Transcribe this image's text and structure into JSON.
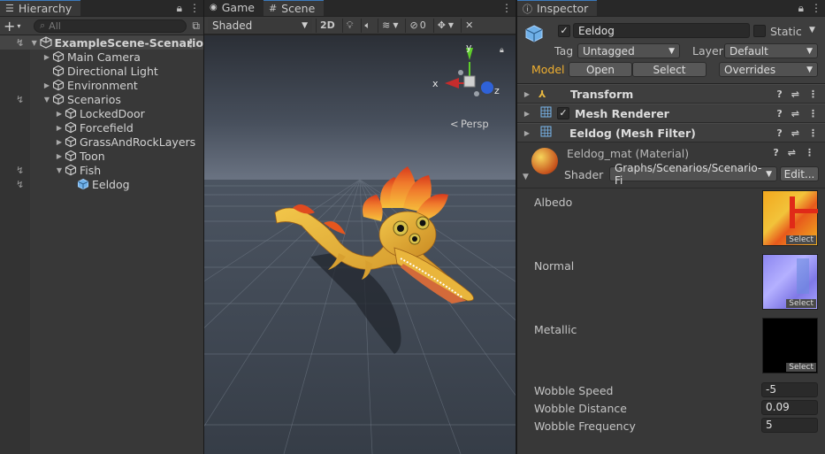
{
  "hierarchy": {
    "tab_label": "Hierarchy",
    "search_placeholder": "All",
    "scene_name": "ExampleScene-Scenario",
    "items": [
      {
        "label": "Main Camera"
      },
      {
        "label": "Directional Light"
      },
      {
        "label": "Environment"
      },
      {
        "label": "Scenarios"
      },
      {
        "label": "LockedDoor"
      },
      {
        "label": "Forcefield"
      },
      {
        "label": "GrassAndRockLayers"
      },
      {
        "label": "Toon"
      },
      {
        "label": "Fish"
      },
      {
        "label": "Eeldog"
      }
    ]
  },
  "scene": {
    "tabs": [
      {
        "label": "Game"
      },
      {
        "label": "Scene"
      }
    ],
    "draw_mode": "Shaded",
    "mode_2d": "2D",
    "hidden_count": "0",
    "gizmo": {
      "y": "y",
      "x": "x",
      "z": "z",
      "projection": "Persp"
    }
  },
  "inspector": {
    "tab_label": "Inspector",
    "object_name": "Eeldog",
    "static_label": "Static",
    "tag_label": "Tag",
    "tag_value": "Untagged",
    "layer_label": "Layer",
    "layer_value": "Default",
    "model_label": "Model",
    "open_label": "Open",
    "select_label": "Select",
    "overrides_label": "Overrides",
    "components": [
      {
        "label": "Transform"
      },
      {
        "label": "Mesh Renderer"
      },
      {
        "label": "Eeldog (Mesh Filter)"
      }
    ],
    "material": {
      "name": "Eeldog_mat (Material)",
      "shader_label": "Shader",
      "shader_value": "Graphs/Scenarios/Scenario-Fi",
      "edit_label": "Edit..."
    },
    "textures": [
      {
        "label": "Albedo",
        "select": "Select"
      },
      {
        "label": "Normal",
        "select": "Select"
      },
      {
        "label": "Metallic",
        "select": "Select"
      }
    ],
    "properties": [
      {
        "label": "Wobble Speed",
        "value": "-5"
      },
      {
        "label": "Wobble Distance",
        "value": "0.09"
      },
      {
        "label": "Wobble Frequency",
        "value": "5"
      }
    ]
  },
  "colors": {
    "accent": "#3a79bb",
    "model_label": "#f0b030",
    "sky": "#4a5568",
    "ground": "#39424c"
  }
}
